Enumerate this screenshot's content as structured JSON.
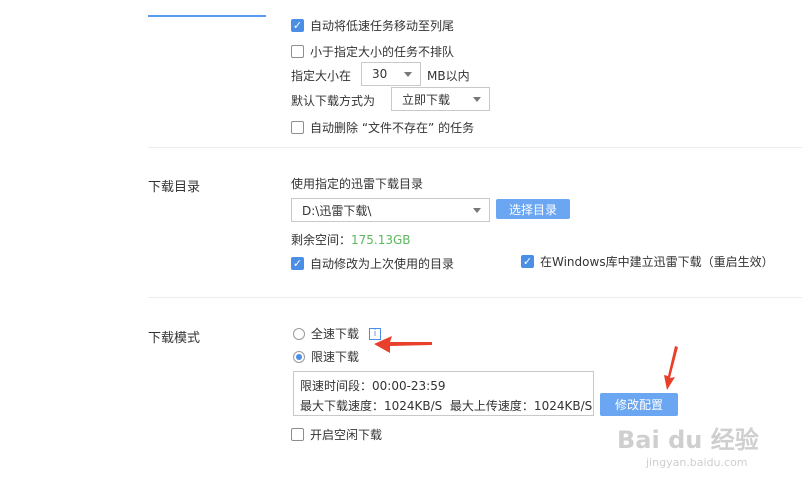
{
  "queue": {
    "auto_move_slow": "自动将低速任务移动至列尾",
    "small_no_queue": "小于指定大小的任务不排队",
    "size_label": "指定大小在",
    "size_value": "30",
    "size_unit": "MB以内",
    "default_method_label": "默认下载方式为",
    "default_method_value": "立即下载",
    "auto_delete": "自动删除 “文件不存在” 的任务"
  },
  "directory": {
    "section_title": "下载目录",
    "use_specified": "使用指定的迅雷下载目录",
    "path_value": "D:\\迅雷下载\\",
    "choose_button": "选择目录",
    "free_space_label": "剩余空间：",
    "free_space_value": "175.13GB",
    "auto_modify_last": "自动修改为上次使用的目录",
    "windows_library": "在Windows库中建立迅雷下载（重启生效）"
  },
  "mode": {
    "section_title": "下载模式",
    "full_speed": "全速下载",
    "limited_speed": "限速下载",
    "limit_period": "限速时间段：00:00-23:59",
    "limit_speeds": "最大下载速度：1024KB/S  最大上传速度：1024KB/S",
    "modify_button": "修改配置",
    "idle_download": "开启空闲下载"
  },
  "watermark": {
    "logo_text": "Bai du 经验",
    "url": "jingyan.baidu.com"
  },
  "colors": {
    "accent": "#4a8ee6",
    "button": "#6aa6f2",
    "free_space": "#5cb85c",
    "annotation_arrow": "#e8402a"
  }
}
